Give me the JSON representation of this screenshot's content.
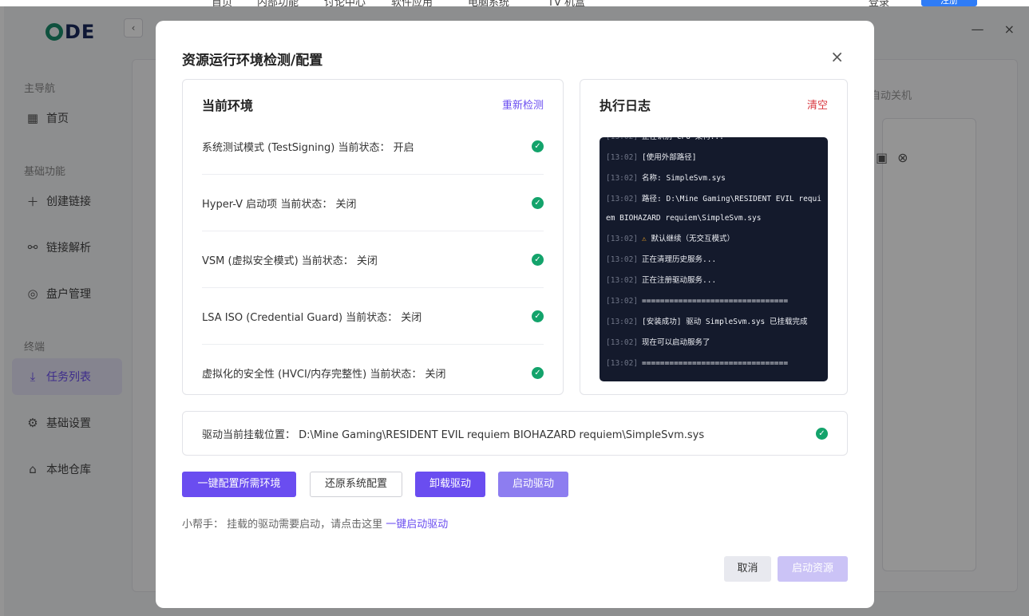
{
  "topnav": {
    "items": [
      "首页",
      "内部功能",
      "讨论中心",
      "软件应用",
      "电脑系统",
      "TV 机盒"
    ],
    "login": "登录",
    "signup": "注册"
  },
  "app": {
    "logo": "DE",
    "collapse_icon": "‹",
    "minimize_icon": "—",
    "close_icon": "×"
  },
  "sidebar": {
    "sections": [
      "主导航",
      "基础功能",
      "终端"
    ],
    "items": [
      {
        "label": "首页",
        "icon": "grid-icon"
      },
      {
        "label": "创建链接",
        "icon": "plus-icon"
      },
      {
        "label": "链接解析",
        "icon": "link-icon"
      },
      {
        "label": "盘户管理",
        "icon": "user-icon"
      },
      {
        "label": "任务列表",
        "icon": "download-icon"
      },
      {
        "label": "基础设置",
        "icon": "gear-icon"
      },
      {
        "label": "本地仓库",
        "icon": "store-icon"
      }
    ]
  },
  "background": {
    "label": "自动关机"
  },
  "modal": {
    "title": "资源运行环境检测/配置",
    "close_icon": "×",
    "env": {
      "title": "当前环境",
      "action": "重新检测",
      "rows": [
        {
          "text": "系统测试模式 (TestSigning) 当前状态： 开启"
        },
        {
          "text": "Hyper-V 启动项 当前状态： 关闭"
        },
        {
          "text": "VSM (虚拟安全模式) 当前状态： 关闭"
        },
        {
          "text": "LSA ISO (Credential Guard) 当前状态： 关闭"
        },
        {
          "text": "虚拟化的安全性 (HVCI/内存完整性) 当前状态： 关闭"
        }
      ]
    },
    "log": {
      "title": "执行日志",
      "action": "清空",
      "lines": [
        {
          "ts": "[13:02]",
          "msg": "正在识别 CPU 架构..."
        },
        {
          "ts": "[13:02]",
          "msg": "[使用外部路径]"
        },
        {
          "ts": "[13:02]",
          "msg": "名称: SimpleSvm.sys"
        },
        {
          "ts": "[13:02]",
          "msg": "路径: D:\\Mine Gaming\\RESIDENT EVIL requiem BIOHAZARD requiem\\SimpleSvm.sys"
        },
        {
          "ts": "[13:02]",
          "msg": "⚠ 默认继续（无交互模式）"
        },
        {
          "ts": "[13:02]",
          "msg": "正在清理历史服务..."
        },
        {
          "ts": "[13:02]",
          "msg": "正在注册驱动服务..."
        },
        {
          "ts": "[13:02]",
          "msg": "================================"
        },
        {
          "ts": "[13:02]",
          "msg": "[安装成功] 驱动 SimpleSvm.sys 已挂载完成"
        },
        {
          "ts": "[13:02]",
          "msg": "现在可以启动服务了"
        },
        {
          "ts": "[13:02]",
          "msg": "================================"
        }
      ]
    },
    "driver": {
      "text": "驱动当前挂载位置： D:\\Mine Gaming\\RESIDENT EVIL requiem BIOHAZARD requiem\\SimpleSvm.sys"
    },
    "buttons": {
      "config_all": "一键配置所需环境",
      "restore": "还原系统配置",
      "unload": "卸载驱动",
      "start_driver": "启动驱动"
    },
    "helper": {
      "prefix": "小帮手： 挂载的驱动需要启动，请点击这里 ",
      "link": "一键启动驱动"
    },
    "footer": {
      "cancel": "取消",
      "start_resource": "启动资源"
    }
  },
  "colors": {
    "accent": "#6a4df0",
    "success": "#13a36b",
    "danger": "#d9363e",
    "console_bg": "#141a2c"
  }
}
